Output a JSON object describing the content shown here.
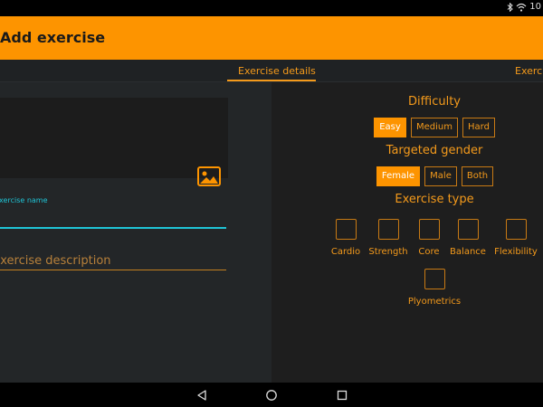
{
  "status_bar": {
    "clock": "10"
  },
  "app_bar": {
    "title": "Add exercise"
  },
  "tabs": [
    {
      "label": "Exercise details",
      "selected": true
    },
    {
      "label": "Exercis"
    }
  ],
  "form": {
    "name_label": "Exercise name",
    "name_value": "",
    "description_placeholder": "Exercise description"
  },
  "difficulty": {
    "title": "Difficulty",
    "options": [
      "Easy",
      "Medium",
      "Hard"
    ],
    "selected": "Easy"
  },
  "gender": {
    "title": "Targeted gender",
    "options": [
      "Female",
      "Male",
      "Both"
    ],
    "selected": "Female"
  },
  "exercise_type": {
    "title": "Exercise type",
    "options": [
      "Cardio",
      "Strength",
      "Core",
      "Balance",
      "Flexibility",
      "Plyometrics"
    ]
  },
  "colors": {
    "accent": "#fd9400",
    "focus": "#1fc4d6",
    "panel_dark": "#232628"
  },
  "icons": {
    "image_picker": "image-icon",
    "nav_back": "back-triangle-icon",
    "nav_home": "home-circle-icon",
    "nav_recents": "recents-square-icon"
  }
}
